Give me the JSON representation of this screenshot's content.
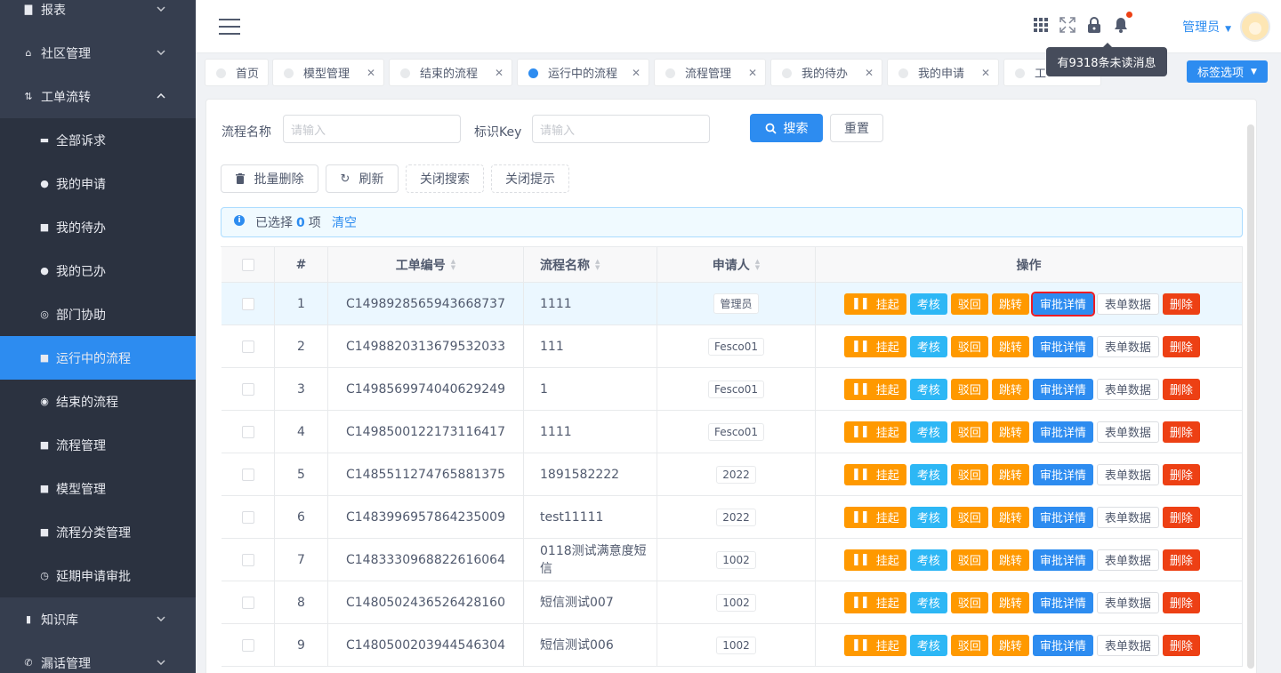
{
  "sidebar": {
    "items": [
      {
        "label": "报表",
        "type": "top",
        "icon": "chart-icon",
        "chevron": "down"
      },
      {
        "label": "社区管理",
        "type": "top",
        "icon": "home-icon",
        "chevron": "down"
      },
      {
        "label": "工单流转",
        "type": "top",
        "icon": "flow-icon",
        "chevron": "up"
      },
      {
        "label": "全部诉求",
        "type": "sub",
        "icon": "folder-icon"
      },
      {
        "label": "我的申请",
        "type": "sub",
        "icon": "circle-icon"
      },
      {
        "label": "我的待办",
        "type": "sub",
        "icon": "doc-icon"
      },
      {
        "label": "我的已办",
        "type": "sub",
        "icon": "circle-icon"
      },
      {
        "label": "部门协助",
        "type": "sub",
        "icon": "team-icon"
      },
      {
        "label": "运行中的流程",
        "type": "sub",
        "icon": "doc-icon",
        "active": true
      },
      {
        "label": "结束的流程",
        "type": "sub",
        "icon": "stop-icon"
      },
      {
        "label": "流程管理",
        "type": "sub",
        "icon": "doc-icon"
      },
      {
        "label": "模型管理",
        "type": "sub",
        "icon": "doc-icon"
      },
      {
        "label": "流程分类管理",
        "type": "sub",
        "icon": "doc-icon"
      },
      {
        "label": "延期申请审批",
        "type": "sub",
        "icon": "clock-icon"
      },
      {
        "label": "知识库",
        "type": "top",
        "icon": "book-icon",
        "chevron": "down"
      },
      {
        "label": "漏话管理",
        "type": "top",
        "icon": "phone-icon",
        "chevron": "down"
      }
    ]
  },
  "header": {
    "admin_label": "管理员",
    "tooltip": "有9318条未读消息"
  },
  "tabs": [
    {
      "label": "首页",
      "closable": false
    },
    {
      "label": "模型管理",
      "closable": true
    },
    {
      "label": "结束的流程",
      "closable": true
    },
    {
      "label": "运行中的流程",
      "closable": true,
      "active": true
    },
    {
      "label": "流程管理",
      "closable": true
    },
    {
      "label": "我的待办",
      "closable": true
    },
    {
      "label": "我的申请",
      "closable": true
    },
    {
      "label": "工",
      "closable": false
    }
  ],
  "tag_options_label": "标签选项",
  "search": {
    "name_label": "流程名称",
    "name_placeholder": "请输入",
    "key_label": "标识Key",
    "key_placeholder": "请输入",
    "search_button": "搜索",
    "reset_button": "重置"
  },
  "toolbar": {
    "batch_delete": "批量删除",
    "refresh": "刷新",
    "close_search": "关闭搜索",
    "close_tip": "关闭提示"
  },
  "alert": {
    "prefix": "已选择",
    "count": "0",
    "suffix": "项",
    "clear": "清空"
  },
  "table": {
    "columns": [
      "#",
      "工单编号",
      "流程名称",
      "申请人",
      "操作"
    ],
    "action_labels": [
      "挂起",
      "考核",
      "驳回",
      "跳转",
      "审批详情",
      "表单数据",
      "删除"
    ],
    "rows": [
      {
        "index": "1",
        "id": "C1498928565943668737",
        "name": "1111",
        "applicant": "管理员"
      },
      {
        "index": "2",
        "id": "C1498820313679532033",
        "name": "111",
        "applicant": "Fesco01"
      },
      {
        "index": "3",
        "id": "C1498569974040629249",
        "name": "1",
        "applicant": "Fesco01"
      },
      {
        "index": "4",
        "id": "C1498500122173116417",
        "name": "1111",
        "applicant": "Fesco01"
      },
      {
        "index": "5",
        "id": "C1485511274765881375",
        "name": "1891582222",
        "applicant": "2022"
      },
      {
        "index": "6",
        "id": "C1483996957864235009",
        "name": "test11111",
        "applicant": "2022"
      },
      {
        "index": "7",
        "id": "C1483330968822616064",
        "name": "0118测试满意度短信",
        "applicant": "1002"
      },
      {
        "index": "8",
        "id": "C1480502436526428160",
        "name": "短信测试007",
        "applicant": "1002"
      },
      {
        "index": "9",
        "id": "C1480500203944546304",
        "name": "短信测试006",
        "applicant": "1002"
      }
    ]
  }
}
